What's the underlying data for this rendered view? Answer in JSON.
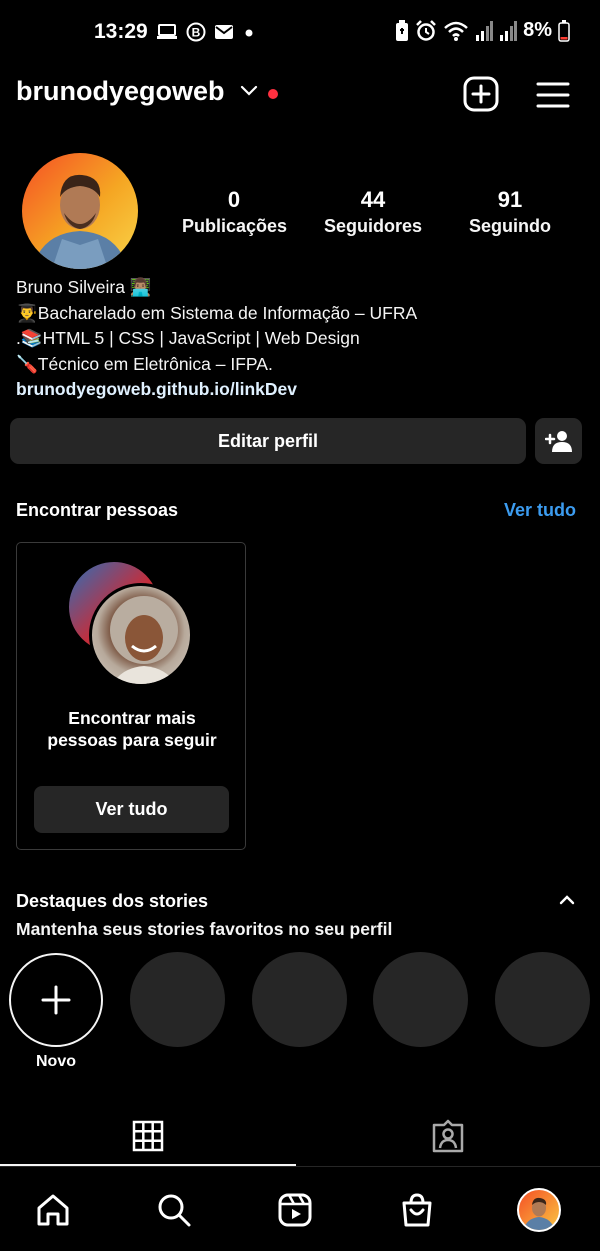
{
  "status_bar": {
    "time": "13:29",
    "battery": "8%",
    "icons_left": [
      "laptop-icon",
      "b-badge-icon",
      "mail-icon",
      "dot-icon"
    ],
    "icons_right": [
      "battery-saver-icon",
      "alarm-icon",
      "wifi-icon",
      "signal-icon",
      "signal-icon",
      "battery-icon"
    ]
  },
  "header": {
    "username": "brunodyegoweb",
    "notification_dot_color": "#ff3040"
  },
  "profile": {
    "stats": [
      {
        "value": "0",
        "label": "Publicações"
      },
      {
        "value": "44",
        "label": "Seguidores"
      },
      {
        "value": "91",
        "label": "Seguindo"
      }
    ],
    "bio": {
      "name": "Bruno Silveira 👨🏽‍💻",
      "line1": "👨‍🎓Bacharelado em Sistema de Informação  – UFRA",
      "line2": ".📚HTML 5 | CSS  | JavaScript | Web Design",
      "line3": "🪛Técnico em Eletrônica – IFPA.",
      "link": "brunodyegoweb.github.io/linkDev"
    },
    "edit_button": "Editar perfil"
  },
  "discover": {
    "title": "Encontrar pessoas",
    "see_all": "Ver tudo",
    "card": {
      "text_line1": "Encontrar mais",
      "text_line2": "pessoas para seguir",
      "button": "Ver tudo"
    }
  },
  "highlights": {
    "title": "Destaques dos stories",
    "subtitle": "Mantenha seus stories favoritos no seu perfil",
    "new_label": "Novo"
  },
  "tabs": [
    "grid-icon",
    "tagged-icon"
  ],
  "bottom_nav": [
    "home-icon",
    "search-icon",
    "reels-icon",
    "shop-icon",
    "profile-avatar"
  ],
  "colors": {
    "background": "#000000",
    "surface": "#262626",
    "link_blue": "#3c9cf0"
  }
}
